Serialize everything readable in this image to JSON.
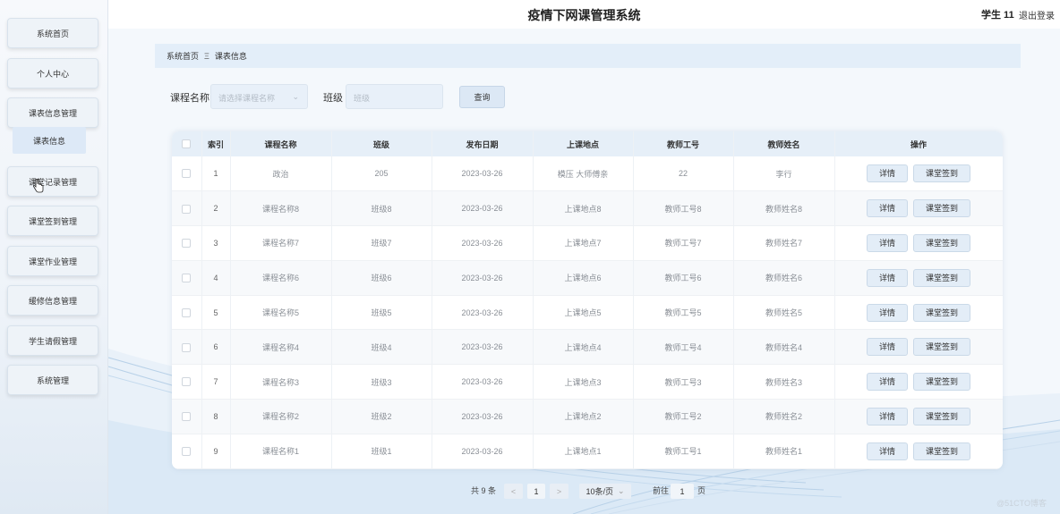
{
  "header": {
    "title": "疫情下网课管理系统",
    "user": "学生 11",
    "logout": "退出登录"
  },
  "sidebar": {
    "items": [
      {
        "label": "系统首页"
      },
      {
        "label": "个人中心"
      },
      {
        "label": "课表信息管理"
      },
      {
        "label": "课堂记录管理"
      },
      {
        "label": "课堂签到管理"
      },
      {
        "label": "课堂作业管理"
      },
      {
        "label": "缓修信息管理"
      },
      {
        "label": "学生请假管理"
      },
      {
        "label": "系统管理"
      }
    ],
    "active_sub": "课表信息"
  },
  "breadcrumb": {
    "home": "系统首页",
    "separator": "Ξ",
    "current": "课表信息"
  },
  "search": {
    "course_label": "课程名称",
    "course_placeholder": "请选择课程名称",
    "class_label": "班级",
    "class_placeholder": "班级",
    "query_button": "查询"
  },
  "table": {
    "columns": [
      "索引",
      "课程名称",
      "班级",
      "发布日期",
      "上课地点",
      "教师工号",
      "教师姓名",
      "操作"
    ],
    "detail_label": "详情",
    "sign_label": "课堂签到",
    "rows": [
      {
        "index": "1",
        "course": "政治",
        "class": "205",
        "date": "2023-03-26",
        "location": "模压 大师傅亲",
        "teacher_id": "22",
        "teacher_name": "李行"
      },
      {
        "index": "2",
        "course": "课程名称8",
        "class": "班级8",
        "date": "2023-03-26",
        "location": "上课地点8",
        "teacher_id": "教师工号8",
        "teacher_name": "教师姓名8"
      },
      {
        "index": "3",
        "course": "课程名称7",
        "class": "班级7",
        "date": "2023-03-26",
        "location": "上课地点7",
        "teacher_id": "教师工号7",
        "teacher_name": "教师姓名7"
      },
      {
        "index": "4",
        "course": "课程名称6",
        "class": "班级6",
        "date": "2023-03-26",
        "location": "上课地点6",
        "teacher_id": "教师工号6",
        "teacher_name": "教师姓名6"
      },
      {
        "index": "5",
        "course": "课程名称5",
        "class": "班级5",
        "date": "2023-03-26",
        "location": "上课地点5",
        "teacher_id": "教师工号5",
        "teacher_name": "教师姓名5"
      },
      {
        "index": "6",
        "course": "课程名称4",
        "class": "班级4",
        "date": "2023-03-26",
        "location": "上课地点4",
        "teacher_id": "教师工号4",
        "teacher_name": "教师姓名4"
      },
      {
        "index": "7",
        "course": "课程名称3",
        "class": "班级3",
        "date": "2023-03-26",
        "location": "上课地点3",
        "teacher_id": "教师工号3",
        "teacher_name": "教师姓名3"
      },
      {
        "index": "8",
        "course": "课程名称2",
        "class": "班级2",
        "date": "2023-03-26",
        "location": "上课地点2",
        "teacher_id": "教师工号2",
        "teacher_name": "教师姓名2"
      },
      {
        "index": "9",
        "course": "课程名称1",
        "class": "班级1",
        "date": "2023-03-26",
        "location": "上课地点1",
        "teacher_id": "教师工号1",
        "teacher_name": "教师姓名1"
      }
    ]
  },
  "pagination": {
    "total": "共 9 条",
    "prev": "<",
    "page": "1",
    "next": ">",
    "page_size": "10条/页",
    "goto_label": "前往",
    "goto_value": "1",
    "page_unit": "页"
  },
  "watermark": "@51CTO博客",
  "colors": {
    "accent": "#e3eef9",
    "header_bg": "#e6eff8",
    "button_bg": "#e3edf7"
  }
}
